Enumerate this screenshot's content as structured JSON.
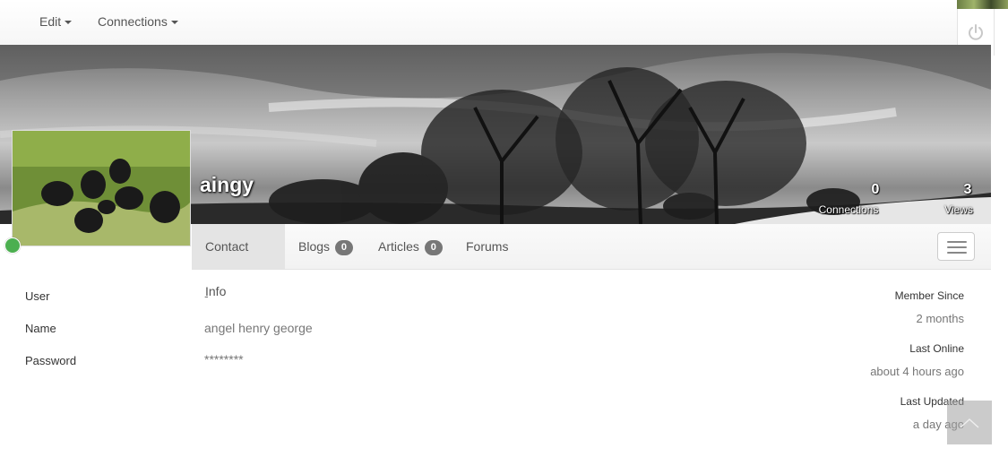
{
  "navbar": {
    "edit_label": "Edit",
    "connections_label": "Connections"
  },
  "profile": {
    "username": "aingy",
    "stats": [
      {
        "value": "0",
        "label": "Connections"
      },
      {
        "value": "3",
        "label": "Views"
      }
    ]
  },
  "tabs": [
    {
      "label": "Contact Info",
      "badge": null
    },
    {
      "label": "Blogs",
      "badge": "0"
    },
    {
      "label": "Articles",
      "badge": "0"
    },
    {
      "label": "Forums",
      "badge": null
    }
  ],
  "contact": {
    "fields": [
      {
        "label": "User",
        "value": "-"
      },
      {
        "label": "Name",
        "value": "angel henry george"
      },
      {
        "label": "Password",
        "value": "********"
      }
    ]
  },
  "meta": [
    {
      "label": "Member Since",
      "value": "2 months"
    },
    {
      "label": "Last Online",
      "value": "about 4 hours ago"
    },
    {
      "label": "Last Updated",
      "value": "a day ago"
    }
  ],
  "icons": {
    "power": "power-icon",
    "menu": "hamburger-menu-icon",
    "scroll_top": "chevron-up-icon"
  },
  "colors": {
    "online": "#4caf50",
    "badge": "#777777"
  }
}
